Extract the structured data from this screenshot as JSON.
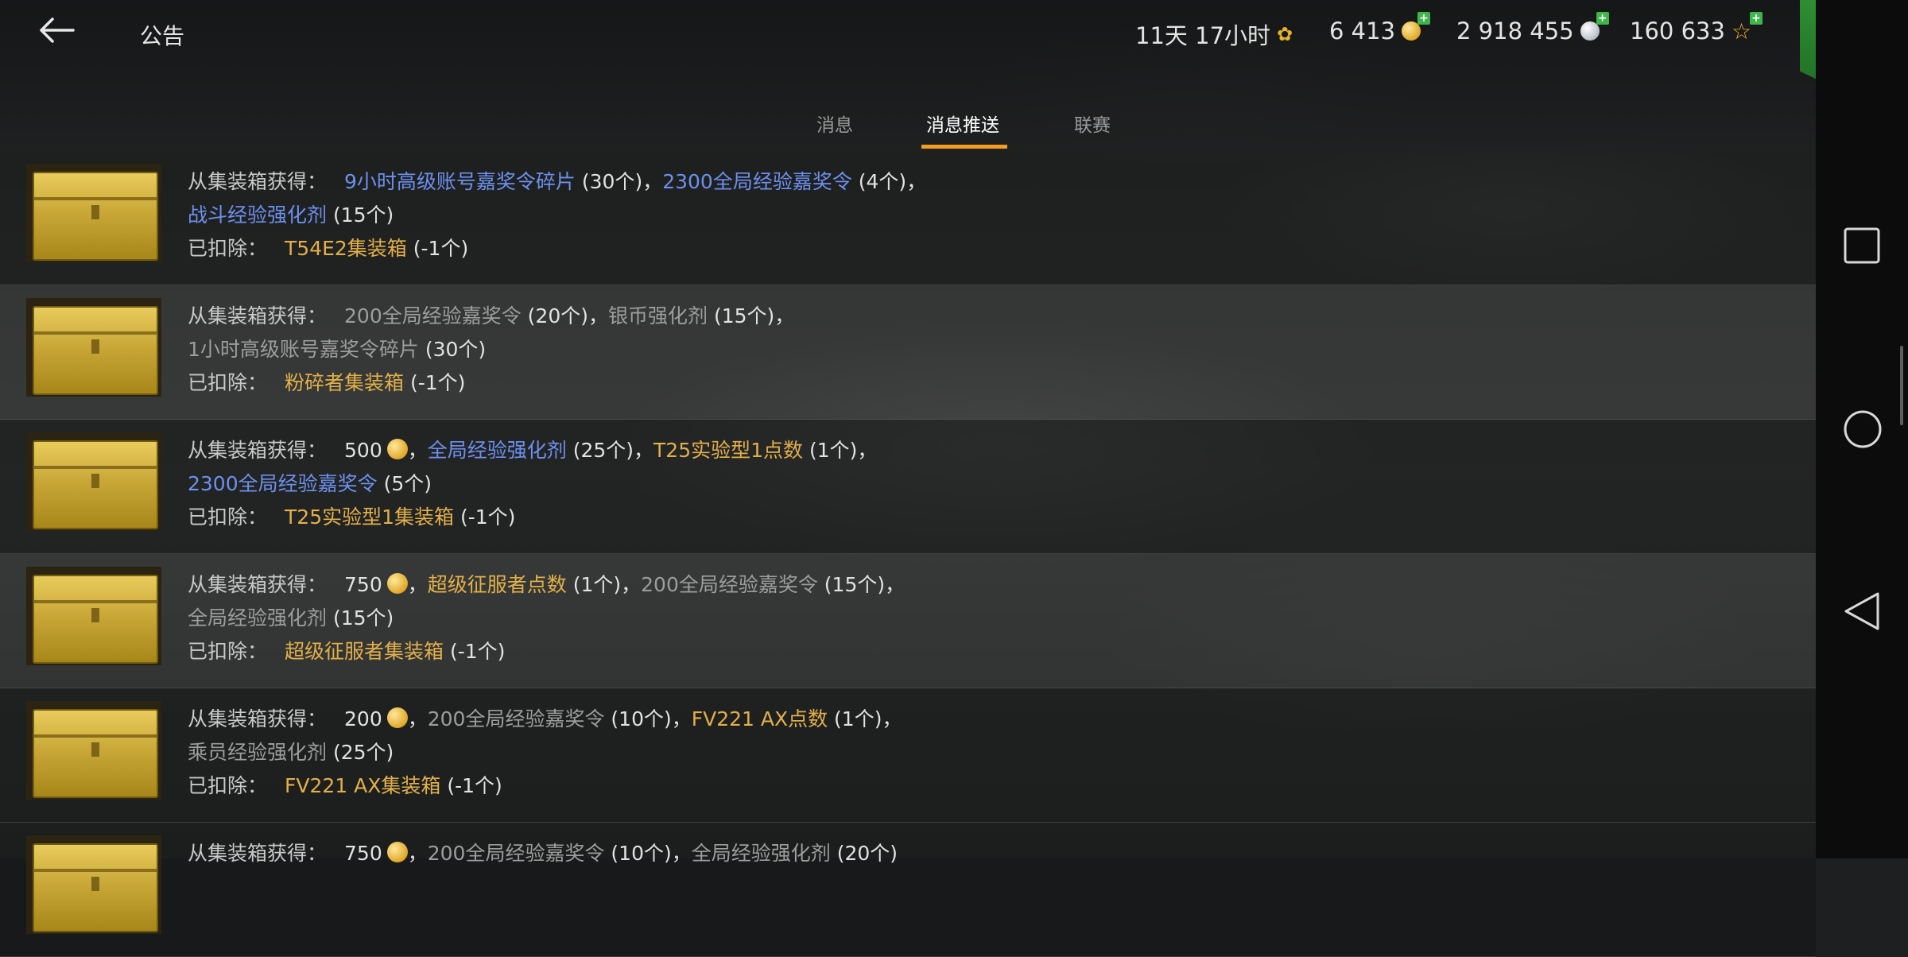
{
  "header": {
    "title": "公告",
    "timer": "11天 17小时",
    "gold": "6 413",
    "silver": "2 918 455",
    "free_xp": "160 633"
  },
  "tabs": [
    {
      "label": "消息"
    },
    {
      "label": "消息推送"
    },
    {
      "label": "联赛"
    }
  ],
  "messages": [
    {
      "obtained_label": "从集装箱获得：",
      "line1": [
        {
          "t": "9小时高级账号嘉奖令碎片",
          "c": "blue"
        },
        {
          "t": " (30个)，",
          "c": "white"
        },
        {
          "t": "2300全局经验嘉奖令",
          "c": "blue"
        },
        {
          "t": " (4个)，",
          "c": "white"
        }
      ],
      "line2": [
        {
          "t": "战斗经验强化剂",
          "c": "blue"
        },
        {
          "t": " (15个)",
          "c": "white"
        }
      ],
      "removed_label": "已扣除：",
      "removed_item": "T54E2集装箱",
      "removed_count": " (-1个)"
    },
    {
      "obtained_label": "从集装箱获得：",
      "line1": [
        {
          "t": "200全局经验嘉奖令",
          "c": "gray"
        },
        {
          "t": " (20个)，",
          "c": "white"
        },
        {
          "t": "银币强化剂",
          "c": "gray"
        },
        {
          "t": " (15个)，",
          "c": "white"
        }
      ],
      "line2": [
        {
          "t": "1小时高级账号嘉奖令碎片",
          "c": "gray"
        },
        {
          "t": " (30个)",
          "c": "white"
        }
      ],
      "removed_label": "已扣除：",
      "removed_item": "粉碎者集装箱",
      "removed_count": " (-1个)"
    },
    {
      "obtained_label": "从集装箱获得：",
      "line1": [
        {
          "t": "500",
          "c": "white"
        },
        {
          "coin": true
        },
        {
          "t": "，",
          "c": "white"
        },
        {
          "t": "全局经验强化剂",
          "c": "blue"
        },
        {
          "t": " (25个)，",
          "c": "white"
        },
        {
          "t": "T25实验型1点数",
          "c": "gold"
        },
        {
          "t": " (1个)，",
          "c": "white"
        }
      ],
      "line2": [
        {
          "t": "2300全局经验嘉奖令",
          "c": "blue"
        },
        {
          "t": " (5个)",
          "c": "white"
        }
      ],
      "removed_label": "已扣除：",
      "removed_item": "T25实验型1集装箱",
      "removed_count": " (-1个)"
    },
    {
      "obtained_label": "从集装箱获得：",
      "line1": [
        {
          "t": "750",
          "c": "white"
        },
        {
          "coin": true
        },
        {
          "t": "，",
          "c": "white"
        },
        {
          "t": "超级征服者点数",
          "c": "gold"
        },
        {
          "t": " (1个)，",
          "c": "white"
        },
        {
          "t": "200全局经验嘉奖令",
          "c": "gray"
        },
        {
          "t": " (15个)，",
          "c": "white"
        }
      ],
      "line2": [
        {
          "t": "全局经验强化剂",
          "c": "gray"
        },
        {
          "t": " (15个)",
          "c": "white"
        }
      ],
      "removed_label": "已扣除：",
      "removed_item": "超级征服者集装箱",
      "removed_count": " (-1个)"
    },
    {
      "obtained_label": "从集装箱获得：",
      "line1": [
        {
          "t": "200",
          "c": "white"
        },
        {
          "coin": true
        },
        {
          "t": "，",
          "c": "white"
        },
        {
          "t": "200全局经验嘉奖令",
          "c": "gray"
        },
        {
          "t": " (10个)，",
          "c": "white"
        },
        {
          "t": "FV221 AX点数",
          "c": "gold"
        },
        {
          "t": " (1个)，",
          "c": "white"
        }
      ],
      "line2": [
        {
          "t": "乘员经验强化剂",
          "c": "gray"
        },
        {
          "t": " (25个)",
          "c": "white"
        }
      ],
      "removed_label": "已扣除：",
      "removed_item": "FV221 AX集装箱",
      "removed_count": " (-1个)"
    },
    {
      "obtained_label": "从集装箱获得：",
      "line1": [
        {
          "t": "750",
          "c": "white"
        },
        {
          "coin": true
        },
        {
          "t": "，",
          "c": "white"
        },
        {
          "t": "200全局经验嘉奖令",
          "c": "gray"
        },
        {
          "t": " (10个)，",
          "c": "white"
        },
        {
          "t": "全局经验强化剂",
          "c": "gray"
        },
        {
          "t": " (20个)",
          "c": "white"
        }
      ],
      "line2": [],
      "removed_label": "",
      "removed_item": "",
      "removed_count": ""
    }
  ],
  "colors": {
    "accent": "#f29c20",
    "blue": "#6d90ee",
    "gold": "#e2b04a",
    "shop": "#2f8e33"
  }
}
